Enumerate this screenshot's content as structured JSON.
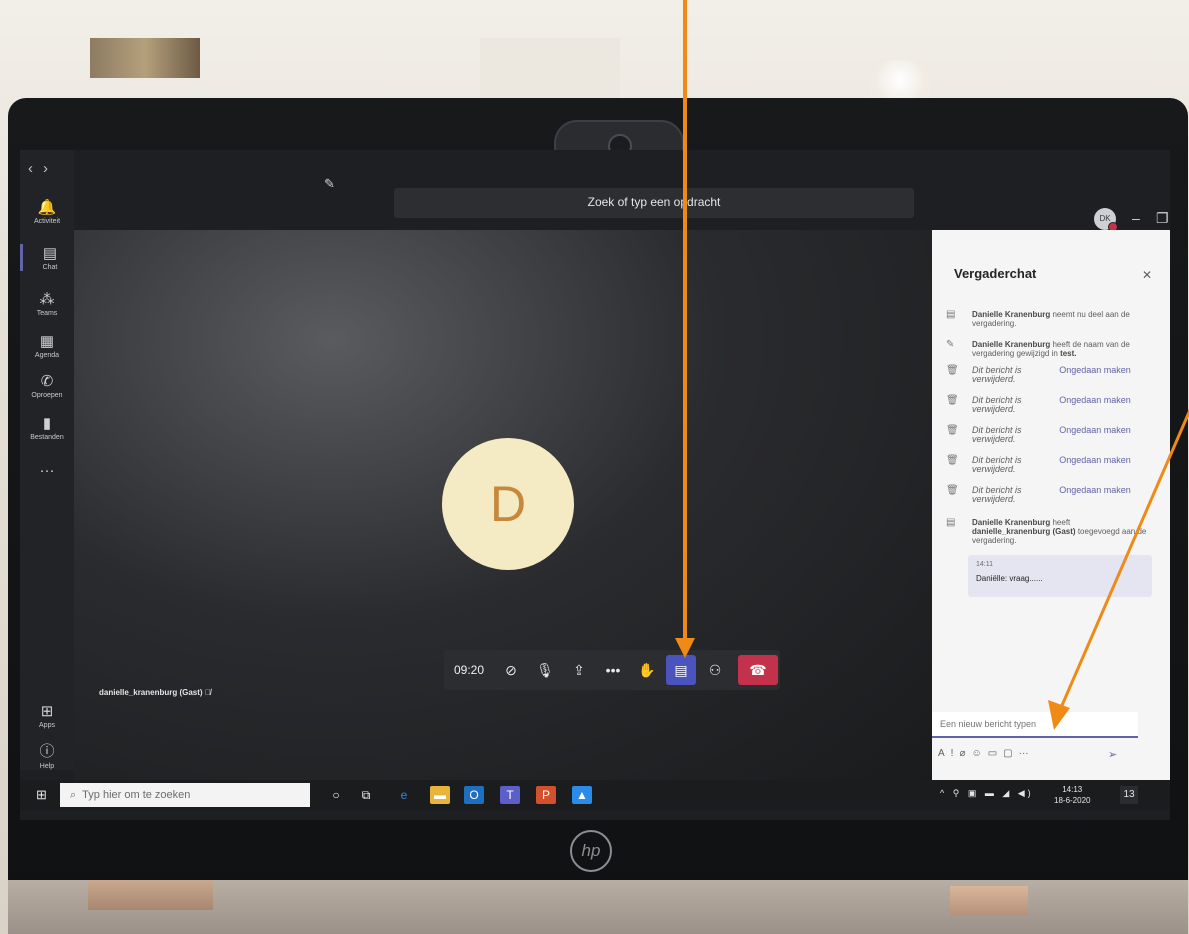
{
  "teams": {
    "search_placeholder": "Zoek of typ een opdracht",
    "user_initials": "DK",
    "rail": [
      {
        "label": "Activiteit",
        "icon": "bell-icon"
      },
      {
        "label": "Chat",
        "icon": "chat-icon"
      },
      {
        "label": "Teams",
        "icon": "teams-icon"
      },
      {
        "label": "Agenda",
        "icon": "calendar-icon"
      },
      {
        "label": "Oproepen",
        "icon": "phone-icon"
      },
      {
        "label": "Bestanden",
        "icon": "files-icon"
      },
      {
        "label": "Apps",
        "icon": "apps-icon"
      },
      {
        "label": "Help",
        "icon": "help-icon"
      }
    ]
  },
  "stage": {
    "avatar_letter": "D",
    "participant_name": "danielle_kranenburg (Gast)"
  },
  "callbar": {
    "timer": "09:20"
  },
  "chat": {
    "title": "Vergaderchat",
    "messages": {
      "joined_name": "Danielle Kranenburg",
      "joined_text": "neemt nu deel aan de vergadering.",
      "renamed_name": "Danielle Kranenburg",
      "renamed_text": "heeft de naam van de vergadering gewijzigd in",
      "renamed_value": "test.",
      "deleted_text": "Dit bericht is verwijderd.",
      "undo_label": "Ongedaan maken",
      "added_name": "Danielle Kranenburg",
      "added_text": "heeft",
      "added_guest": "danielle_kranenburg (Gast)",
      "added_suffix": "toegevoegd aan de vergadering."
    },
    "bubble_time": "14:11",
    "bubble_text": "Daniëlle: vraag......",
    "composer_placeholder": "Een nieuw bericht typen"
  },
  "taskbar": {
    "search_placeholder": "Typ hier om te zoeken",
    "time": "14:13",
    "date": "18-6-2020",
    "notification_count": "13"
  },
  "colors": {
    "teams_purple": "#6264a7",
    "hangup_red": "#c4314b",
    "annotation_arrow": "#f08a16"
  }
}
